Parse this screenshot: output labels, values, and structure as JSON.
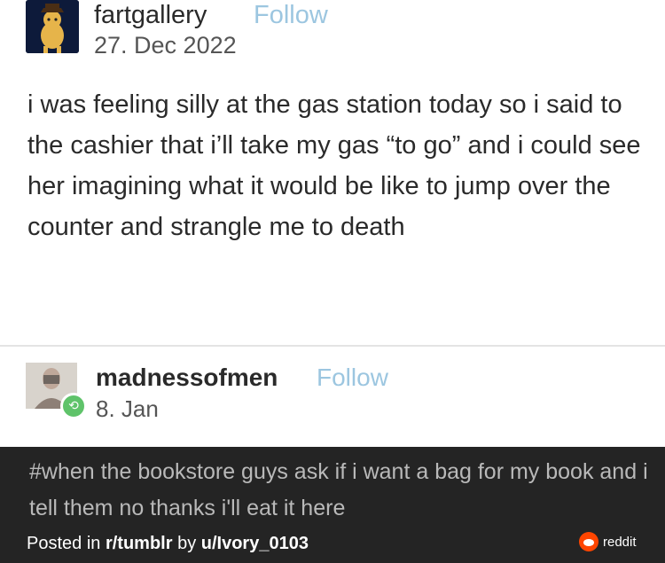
{
  "post": {
    "username": "fartgallery",
    "follow_label": "Follow",
    "date": "27. Dec 2022",
    "text": "i was feeling silly at the gas station today so i said to the cashier that i’ll take my gas “to go” and i could see her imagining what it would be like to jump over the counter and strangle me to death"
  },
  "reblog": {
    "username": "madnessofmen",
    "follow_label": "Follow",
    "date": "8. Jan",
    "tags_text": "#when the bookstore guys ask if i want a bag for my book and i tell them no thanks i'll eat it here"
  },
  "footer": {
    "posted_prefix": "Posted in ",
    "subreddit": "r/tumblr",
    "by_prefix": " by ",
    "user": "u/Ivory_0103",
    "reddit_label": "reddit"
  },
  "colors": {
    "follow": "#9cc6e0",
    "footer_bg": "#242424",
    "reblog_badge": "#5fc36a",
    "reddit_orange": "#ff4500"
  }
}
